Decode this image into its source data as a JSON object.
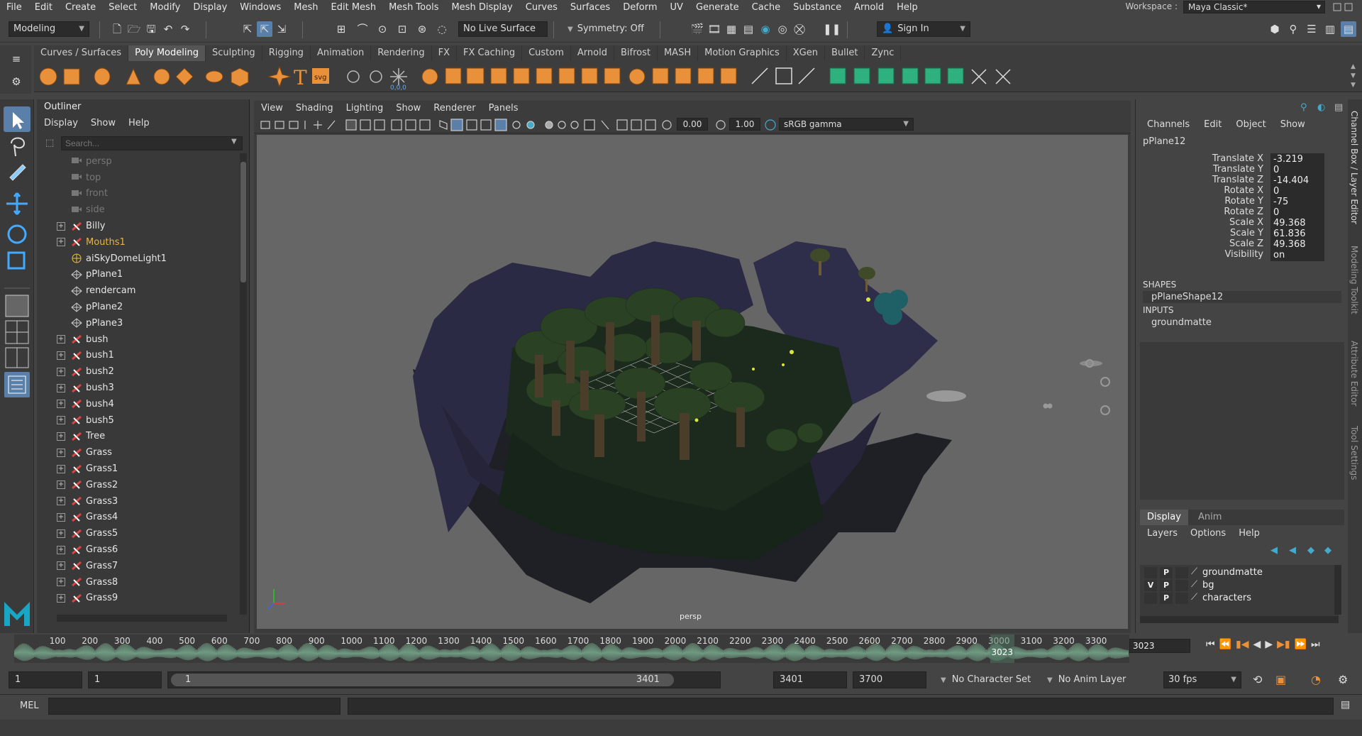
{
  "menubar": {
    "items": [
      "File",
      "Edit",
      "Create",
      "Select",
      "Modify",
      "Display",
      "Windows",
      "Mesh",
      "Edit Mesh",
      "Mesh Tools",
      "Mesh Display",
      "Curves",
      "Surfaces",
      "Deform",
      "UV",
      "Generate",
      "Cache",
      "Substance",
      "Arnold",
      "Help"
    ],
    "workspace_label": "Workspace :",
    "workspace_value": "Maya Classic*"
  },
  "statusline": {
    "mode": "Modeling",
    "live_surface": "No Live Surface",
    "symmetry": "Symmetry: Off",
    "sign_in": "Sign In"
  },
  "shelf_tabs": [
    "Curves / Surfaces",
    "Poly Modeling",
    "Sculpting",
    "Rigging",
    "Animation",
    "Rendering",
    "FX",
    "FX Caching",
    "Custom",
    "Arnold",
    "Bifrost",
    "MASH",
    "Motion Graphics",
    "XGen",
    "Bullet",
    "Zync"
  ],
  "shelf_active": "Poly Modeling",
  "shelf_icon_labels": {
    "text": "T",
    "svg": "svg",
    "zero": "0,0,0"
  },
  "outliner": {
    "title": "Outliner",
    "menus": [
      "Display",
      "Show",
      "Help"
    ],
    "search_placeholder": "Search...",
    "items": [
      {
        "name": "persp",
        "type": "camera",
        "dim": true,
        "expandable": false
      },
      {
        "name": "top",
        "type": "camera",
        "dim": true,
        "expandable": false
      },
      {
        "name": "front",
        "type": "camera",
        "dim": true,
        "expandable": false
      },
      {
        "name": "side",
        "type": "camera",
        "dim": true,
        "expandable": false
      },
      {
        "name": "Billy",
        "type": "group",
        "expandable": true
      },
      {
        "name": "Mouths1",
        "type": "group",
        "expandable": true,
        "highlight": true
      },
      {
        "name": "aiSkyDomeLight1",
        "type": "light",
        "expandable": false
      },
      {
        "name": "pPlane1",
        "type": "mesh",
        "expandable": false
      },
      {
        "name": "rendercam",
        "type": "mesh",
        "expandable": false
      },
      {
        "name": "pPlane2",
        "type": "mesh",
        "expandable": false
      },
      {
        "name": "pPlane3",
        "type": "mesh",
        "expandable": false
      },
      {
        "name": "bush",
        "type": "group",
        "expandable": true
      },
      {
        "name": "bush1",
        "type": "group",
        "expandable": true
      },
      {
        "name": "bush2",
        "type": "group",
        "expandable": true
      },
      {
        "name": "bush3",
        "type": "group",
        "expandable": true
      },
      {
        "name": "bush4",
        "type": "group",
        "expandable": true
      },
      {
        "name": "bush5",
        "type": "group",
        "expandable": true
      },
      {
        "name": "Tree",
        "type": "group",
        "expandable": true
      },
      {
        "name": "Grass",
        "type": "group",
        "expandable": true
      },
      {
        "name": "Grass1",
        "type": "group",
        "expandable": true
      },
      {
        "name": "Grass2",
        "type": "group",
        "expandable": true
      },
      {
        "name": "Grass3",
        "type": "group",
        "expandable": true
      },
      {
        "name": "Grass4",
        "type": "group",
        "expandable": true
      },
      {
        "name": "Grass5",
        "type": "group",
        "expandable": true
      },
      {
        "name": "Grass6",
        "type": "group",
        "expandable": true
      },
      {
        "name": "Grass7",
        "type": "group",
        "expandable": true
      },
      {
        "name": "Grass8",
        "type": "group",
        "expandable": true
      },
      {
        "name": "Grass9",
        "type": "group",
        "expandable": true
      }
    ]
  },
  "viewport": {
    "menus": [
      "View",
      "Shading",
      "Lighting",
      "Show",
      "Renderer",
      "Panels"
    ],
    "exposure": "0.00",
    "gamma": "1.00",
    "color_space": "sRGB gamma",
    "camera_label": "persp"
  },
  "channelbox": {
    "menus": [
      "Channels",
      "Edit",
      "Object",
      "Show"
    ],
    "object": "pPlane12",
    "attributes": [
      {
        "name": "Translate X",
        "value": "-3.219"
      },
      {
        "name": "Translate Y",
        "value": "0"
      },
      {
        "name": "Translate Z",
        "value": "-14.404"
      },
      {
        "name": "Rotate X",
        "value": "0"
      },
      {
        "name": "Rotate Y",
        "value": "-75"
      },
      {
        "name": "Rotate Z",
        "value": "0"
      },
      {
        "name": "Scale X",
        "value": "49.368"
      },
      {
        "name": "Scale Y",
        "value": "61.836"
      },
      {
        "name": "Scale Z",
        "value": "49.368"
      },
      {
        "name": "Visibility",
        "value": "on"
      }
    ],
    "shapes_label": "SHAPES",
    "shape": "pPlaneShape12",
    "inputs_label": "INPUTS",
    "input": "groundmatte"
  },
  "layers": {
    "tabs": [
      "Display",
      "Anim"
    ],
    "active_tab": "Display",
    "menus": [
      "Layers",
      "Options",
      "Help"
    ],
    "rows": [
      {
        "v": "",
        "p": "P",
        "name": "groundmatte"
      },
      {
        "v": "V",
        "p": "P",
        "name": "bg"
      },
      {
        "v": "",
        "p": "P",
        "name": "characters"
      }
    ]
  },
  "side_tabs": [
    "Channel Box / Layer Editor",
    "Modeling Toolkit",
    "Attribute Editor",
    "Tool Settings"
  ],
  "timeline": {
    "ticks": [
      "100",
      "200",
      "300",
      "400",
      "500",
      "600",
      "700",
      "800",
      "900",
      "1000",
      "1100",
      "1200",
      "1300",
      "1400",
      "1500",
      "1600",
      "1700",
      "1800",
      "1900",
      "2000",
      "2100",
      "2200",
      "2300",
      "2400",
      "2500",
      "2600",
      "2700",
      "2800",
      "2900",
      "3000",
      "3100",
      "3200",
      "3300"
    ],
    "current_marker": "3023",
    "current_frame": "3023",
    "range_max": 3401
  },
  "range": {
    "start": "1",
    "anim_start": "1",
    "slider_start": "1",
    "slider_end": "3401",
    "playback_end": "3401",
    "anim_end": "3700",
    "character_set": "No Character Set",
    "anim_layer": "No Anim Layer",
    "fps": "30 fps"
  },
  "cmdline": {
    "label": "MEL"
  }
}
